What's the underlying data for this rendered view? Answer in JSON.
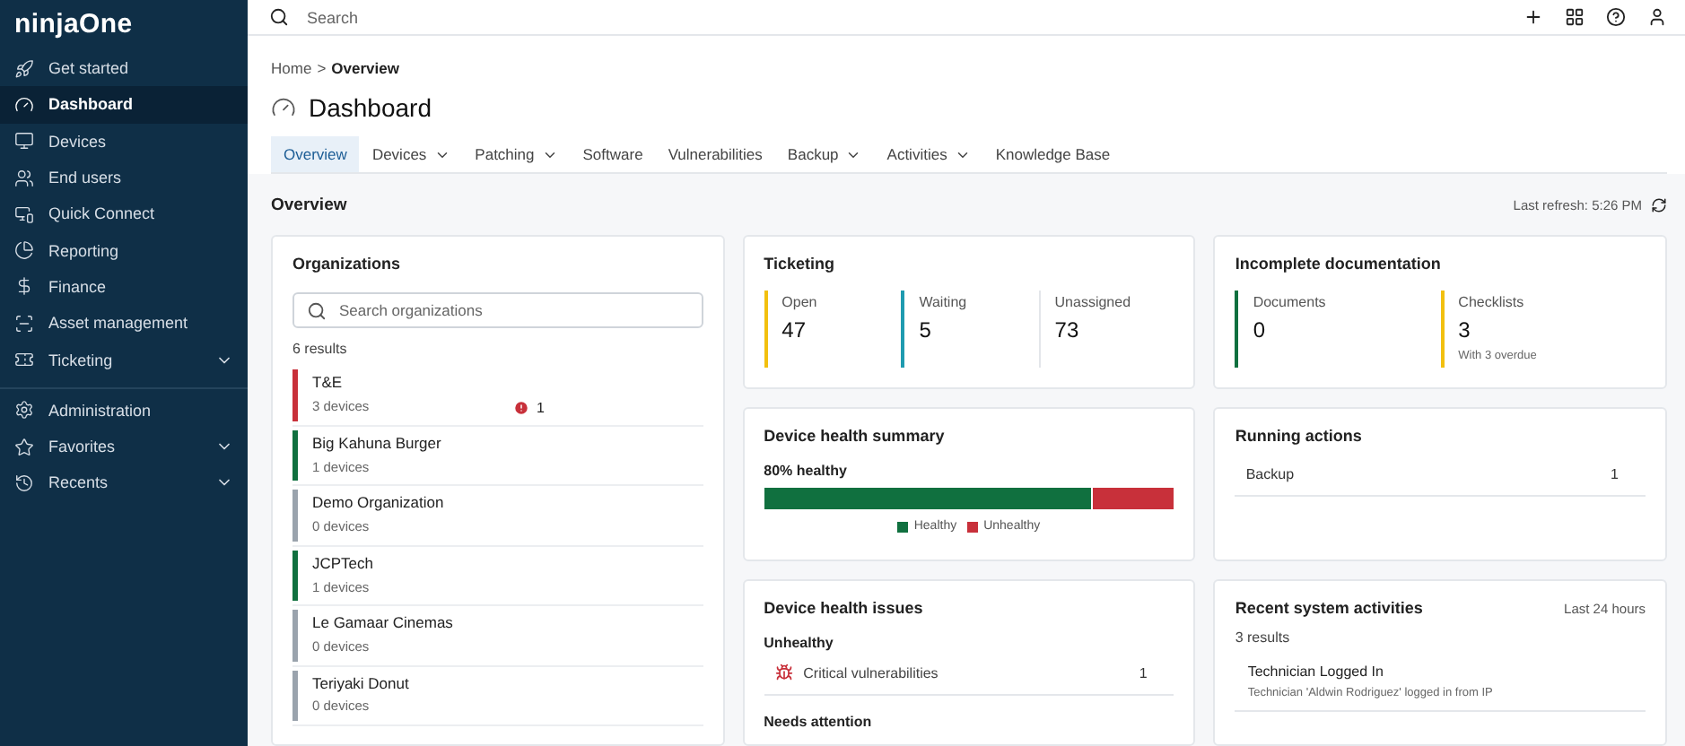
{
  "logo": {
    "text": "ninjaOne"
  },
  "sidebar": {
    "groups": [
      {
        "items": [
          {
            "label": "Get started",
            "selected": false,
            "expandable": false
          },
          {
            "label": "Dashboard",
            "selected": true,
            "expandable": false
          },
          {
            "label": "Devices",
            "selected": false,
            "expandable": false
          },
          {
            "label": "End users",
            "selected": false,
            "expandable": false
          },
          {
            "label": "Quick Connect",
            "selected": false,
            "expandable": false
          },
          {
            "label": "Reporting",
            "selected": false,
            "expandable": false
          },
          {
            "label": "Finance",
            "selected": false,
            "expandable": false
          },
          {
            "label": "Asset management",
            "selected": false,
            "expandable": false
          },
          {
            "label": "Ticketing",
            "selected": false,
            "expandable": true
          }
        ]
      },
      {
        "items": [
          {
            "label": "Administration",
            "selected": false,
            "expandable": false
          },
          {
            "label": "Favorites",
            "selected": false,
            "expandable": true
          },
          {
            "label": "Recents",
            "selected": false,
            "expandable": true
          }
        ]
      }
    ]
  },
  "topbar": {
    "search": {
      "placeholder": "Search"
    }
  },
  "breadcrumb": {
    "parent": "Home",
    "separator": ">",
    "current": "Overview"
  },
  "page_title": "Dashboard",
  "tabs": [
    {
      "label": "Overview",
      "selected": true,
      "dropdown": false
    },
    {
      "label": "Devices",
      "selected": false,
      "dropdown": true
    },
    {
      "label": "Patching",
      "selected": false,
      "dropdown": true
    },
    {
      "label": "Software",
      "selected": false,
      "dropdown": false
    },
    {
      "label": "Vulnerabilities",
      "selected": false,
      "dropdown": false
    },
    {
      "label": "Backup",
      "selected": false,
      "dropdown": true
    },
    {
      "label": "Activities",
      "selected": false,
      "dropdown": true
    },
    {
      "label": "Knowledge Base",
      "selected": false,
      "dropdown": false
    }
  ],
  "section": {
    "title": "Overview",
    "last_refresh": "Last refresh: 5:26 PM"
  },
  "organizations": {
    "title": "Organizations",
    "search": {
      "placeholder": "Search organizations"
    },
    "count": "6 results",
    "items": [
      {
        "name": "T&E",
        "devices": "3 devices",
        "color": "#c8303a",
        "alerts": "1"
      },
      {
        "name": "Big Kahuna Burger",
        "devices": "1 devices",
        "color": "#10703f"
      },
      {
        "name": "Demo Organization",
        "devices": "0 devices",
        "color": "#9aa3ad"
      },
      {
        "name": "JCPTech",
        "devices": "1 devices",
        "color": "#10703f"
      },
      {
        "name": "Le Gamaar Cinemas",
        "devices": "0 devices",
        "color": "#9aa3ad"
      },
      {
        "name": "Teriyaki Donut",
        "devices": "0 devices",
        "color": "#9aa3ad"
      }
    ]
  },
  "ticketing": {
    "title": "Ticketing",
    "stats": [
      {
        "label": "Open",
        "value": "47",
        "color": "#f2c00f"
      },
      {
        "label": "Waiting",
        "value": "5",
        "color": "#1f9bb0"
      },
      {
        "label": "Unassigned",
        "value": "73",
        "color": "#e3e6ea"
      }
    ]
  },
  "documentation": {
    "title": "Incomplete documentation",
    "stats": [
      {
        "label": "Documents",
        "value": "0",
        "color": "#10703f"
      },
      {
        "label": "Checklists",
        "value": "3",
        "color": "#f2c00f",
        "note": "With 3 overdue"
      }
    ]
  },
  "health_summary": {
    "title": "Device health summary",
    "label": "80% healthy",
    "level": 0.8,
    "legend": [
      {
        "label": "Healthy",
        "color": "#10703f"
      },
      {
        "label": "Unhealthy",
        "color": "#c8303a"
      }
    ]
  },
  "running_actions": {
    "title": "Running actions",
    "items": [
      {
        "label": "Backup",
        "count": "1"
      }
    ]
  },
  "health_issues": {
    "title": "Device health issues",
    "groups": [
      {
        "title": "Unhealthy",
        "items": [
          {
            "label": "Critical vulnerabilities",
            "count": "1"
          }
        ]
      },
      {
        "title": "Needs attention"
      }
    ]
  },
  "activities": {
    "title": "Recent system activities",
    "period": "Last 24 hours",
    "count": "3 results",
    "items": [
      {
        "title": "Technician Logged In",
        "detail": "Technician 'Aldwin Rodriguez' logged in from IP"
      }
    ]
  }
}
